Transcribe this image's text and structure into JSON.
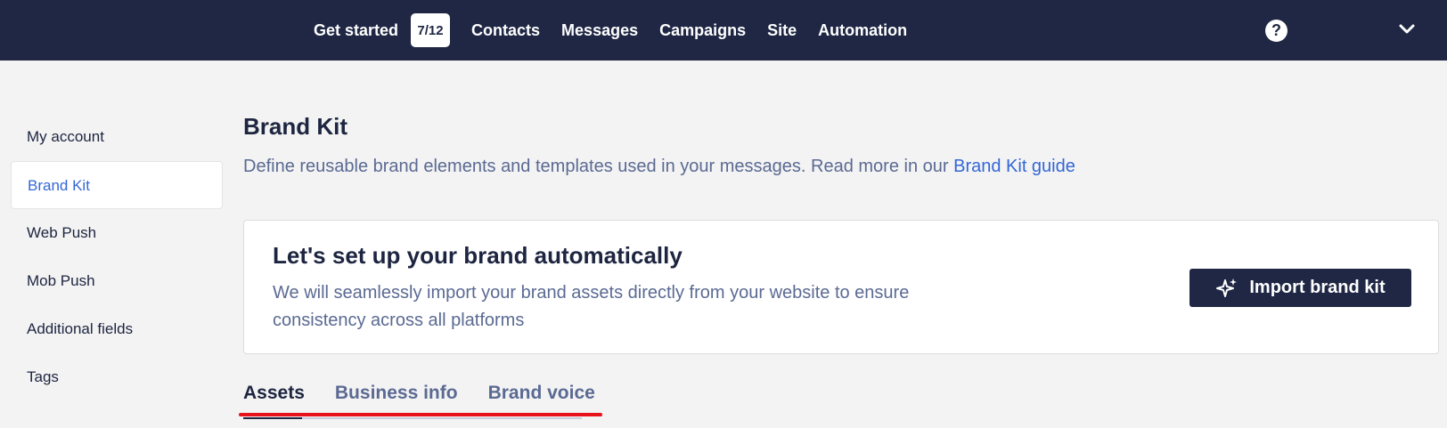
{
  "header": {
    "nav": [
      {
        "label": "Get started",
        "badge": "7/12"
      },
      {
        "label": "Contacts"
      },
      {
        "label": "Messages"
      },
      {
        "label": "Campaigns"
      },
      {
        "label": "Site"
      },
      {
        "label": "Automation"
      }
    ],
    "help_icon": "question-circle-icon",
    "help_glyph": "?",
    "menu_icon": "chevron-down-icon"
  },
  "sidebar": {
    "items": [
      {
        "label": "My account"
      },
      {
        "label": "Brand Kit",
        "active": true
      },
      {
        "label": "Web Push"
      },
      {
        "label": "Mob Push"
      },
      {
        "label": "Additional fields"
      },
      {
        "label": "Tags"
      }
    ]
  },
  "main": {
    "title": "Brand Kit",
    "description": "Define reusable brand elements and templates used in your messages. Read more in our ",
    "guide_link": "Brand Kit guide",
    "promo": {
      "title": "Let's set up your brand automatically",
      "text": "We will seamlessly import your brand assets directly from your website to ensure consistency across all platforms",
      "button_label": "Import brand kit",
      "button_icon": "sparkle-icon"
    },
    "tabs": [
      {
        "label": "Assets",
        "active": true
      },
      {
        "label": "Business info"
      },
      {
        "label": "Brand voice"
      }
    ]
  },
  "colors": {
    "nav_bg": "#1f2744",
    "accent": "#3467d6",
    "annotation": "#e8121b"
  }
}
